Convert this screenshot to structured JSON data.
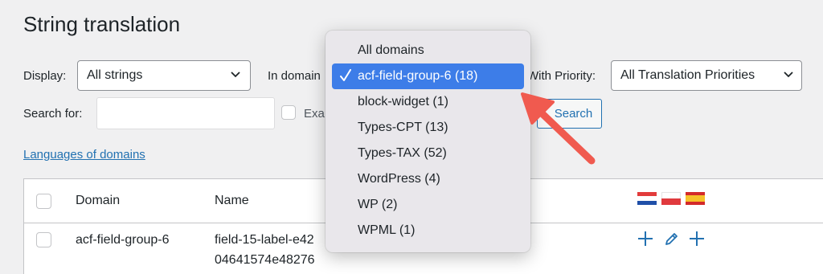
{
  "page": {
    "title": "String translation"
  },
  "filters": {
    "display_label": "Display:",
    "display_value": "All strings",
    "in_domain_label": "In domain",
    "priority_label": "With Priority:",
    "priority_value": "All Translation Priorities",
    "search_label": "Search for:",
    "search_value": "",
    "exact_label": "Exa",
    "search_button": "Search"
  },
  "links": {
    "languages_of_domains": "Languages of domains"
  },
  "table": {
    "headers": {
      "domain": "Domain",
      "name": "Name"
    },
    "flags": [
      "croatian-flag",
      "polish-flag",
      "spanish-flag"
    ],
    "rows": [
      {
        "domain": "acf-field-group-6",
        "name_line1": "field-15-label-e42",
        "name_line2": "04641574e48276",
        "actions": [
          "plus-icon",
          "pencil-icon",
          "plus-icon"
        ]
      }
    ]
  },
  "dropdown": {
    "selected_index": 1,
    "options": [
      "All domains",
      "acf-field-group-6 (18)",
      "block-widget (1)",
      "Types-CPT (13)",
      "Types-TAX (52)",
      "WordPress (4)",
      "WP (2)",
      "WPML (1)"
    ]
  },
  "colors": {
    "accent": "#2271b1",
    "selected": "#3d7de8",
    "arrow": "#f05a4f"
  }
}
